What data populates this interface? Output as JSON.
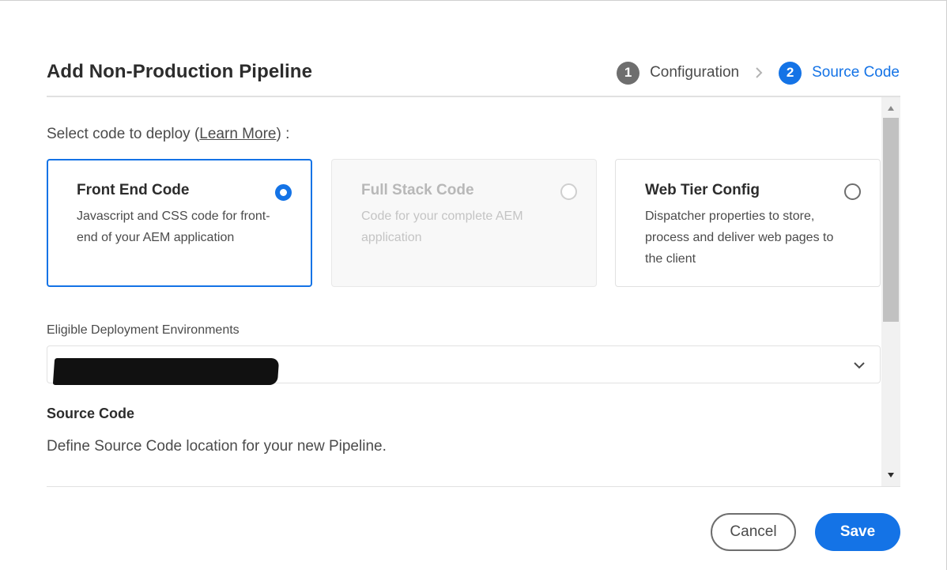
{
  "dialog": {
    "title": "Add Non-Production Pipeline"
  },
  "steps": [
    {
      "number": "1",
      "label": "Configuration",
      "state": "done"
    },
    {
      "number": "2",
      "label": "Source Code",
      "state": "active"
    }
  ],
  "select_code": {
    "prefix": "Select code to deploy",
    "open_paren": "(",
    "link": "Learn More",
    "suffix": ") :"
  },
  "options": [
    {
      "title": "Front End Code",
      "description": "Javascript and CSS code for front-end of your AEM application",
      "selected": true,
      "disabled": false
    },
    {
      "title": "Full Stack Code",
      "description": "Code for your complete AEM application",
      "selected": false,
      "disabled": true
    },
    {
      "title": "Web Tier Config",
      "description": "Dispatcher properties to store, process and deliver web pages to the client",
      "selected": false,
      "disabled": false
    }
  ],
  "environments": {
    "label": "Eligible Deployment Environments",
    "value": ""
  },
  "source_code": {
    "title": "Source Code",
    "description": "Define Source Code location for your new Pipeline."
  },
  "footer": {
    "cancel_label": "Cancel",
    "save_label": "Save"
  },
  "colors": {
    "accent": "#1473e6",
    "step_done": "#6e6e6e"
  },
  "icons": {
    "step_separator": "chevron-right-icon",
    "dropdown": "chevron-down-icon",
    "scroll_up": "triangle-up-icon",
    "scroll_down": "triangle-down-icon"
  }
}
